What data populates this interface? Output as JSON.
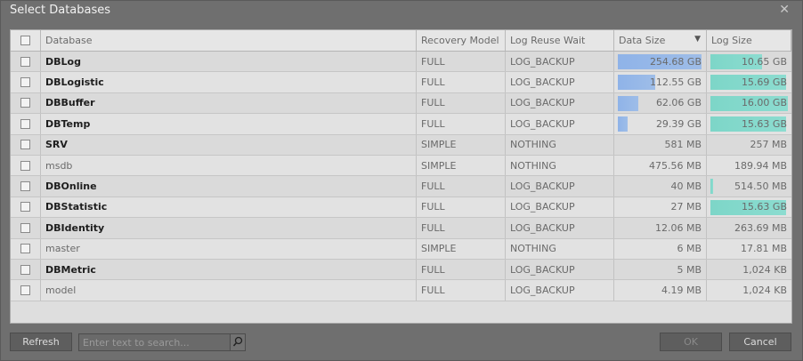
{
  "window": {
    "title": "Select Databases"
  },
  "grid": {
    "columns": [
      "Database",
      "Recovery Model",
      "Log Reuse Wait",
      "Data Size",
      "Log Size"
    ],
    "sort": {
      "column": "Data Size",
      "direction": "descending"
    },
    "rows": [
      {
        "name": "DBLog",
        "recovery": "FULL",
        "reuse": "LOG_BACKUP",
        "data_size": "254.68 GB",
        "log_size": "10.65 GB",
        "data_fill": 1.0,
        "log_fill": 0.667,
        "bold": true
      },
      {
        "name": "DBLogistic",
        "recovery": "FULL",
        "reuse": "LOG_BACKUP",
        "data_size": "112.55 GB",
        "log_size": "15.69 GB",
        "data_fill": 0.442,
        "log_fill": 0.98,
        "bold": true
      },
      {
        "name": "DBBuffer",
        "recovery": "FULL",
        "reuse": "LOG_BACKUP",
        "data_size": "62.06 GB",
        "log_size": "16.00 GB",
        "data_fill": 0.244,
        "log_fill": 1.0,
        "bold": true
      },
      {
        "name": "DBTemp",
        "recovery": "FULL",
        "reuse": "LOG_BACKUP",
        "data_size": "29.39 GB",
        "log_size": "15.63 GB",
        "data_fill": 0.115,
        "log_fill": 0.977,
        "bold": true
      },
      {
        "name": "SRV",
        "recovery": "SIMPLE",
        "reuse": "NOTHING",
        "data_size": "581 MB",
        "log_size": "257 MB",
        "data_fill": 0,
        "log_fill": 0,
        "bold": true
      },
      {
        "name": "msdb",
        "recovery": "SIMPLE",
        "reuse": "NOTHING",
        "data_size": "475.56 MB",
        "log_size": "189.94 MB",
        "data_fill": 0,
        "log_fill": 0,
        "bold": false
      },
      {
        "name": "DBOnline",
        "recovery": "FULL",
        "reuse": "LOG_BACKUP",
        "data_size": "40 MB",
        "log_size": "514.50 MB",
        "data_fill": 0,
        "log_fill": 0.031,
        "bold": true
      },
      {
        "name": "DBStatistic",
        "recovery": "FULL",
        "reuse": "LOG_BACKUP",
        "data_size": "27 MB",
        "log_size": "15.63 GB",
        "data_fill": 0,
        "log_fill": 0.977,
        "bold": true
      },
      {
        "name": "DBIdentity",
        "recovery": "FULL",
        "reuse": "LOG_BACKUP",
        "data_size": "12.06 MB",
        "log_size": "263.69 MB",
        "data_fill": 0,
        "log_fill": 0,
        "bold": true
      },
      {
        "name": "master",
        "recovery": "SIMPLE",
        "reuse": "NOTHING",
        "data_size": "6 MB",
        "log_size": "17.81 MB",
        "data_fill": 0,
        "log_fill": 0,
        "bold": false
      },
      {
        "name": "DBMetric",
        "recovery": "FULL",
        "reuse": "LOG_BACKUP",
        "data_size": "5 MB",
        "log_size": "1,024 KB",
        "data_fill": 0,
        "log_fill": 0,
        "bold": true
      },
      {
        "name": "model",
        "recovery": "FULL",
        "reuse": "LOG_BACKUP",
        "data_size": "4.19 MB",
        "log_size": "1,024 KB",
        "data_fill": 0,
        "log_fill": 0,
        "bold": false
      }
    ]
  },
  "footer": {
    "refresh_label": "Refresh",
    "search_placeholder": "Enter text to search...",
    "ok_label": "OK",
    "cancel_label": "Cancel"
  },
  "icons": {
    "close": "close-icon",
    "search": "search-icon",
    "sort": "sort-descending-icon"
  },
  "colors": {
    "data_bar": "#8fb3e8",
    "log_bar": "#7dd6c8"
  }
}
